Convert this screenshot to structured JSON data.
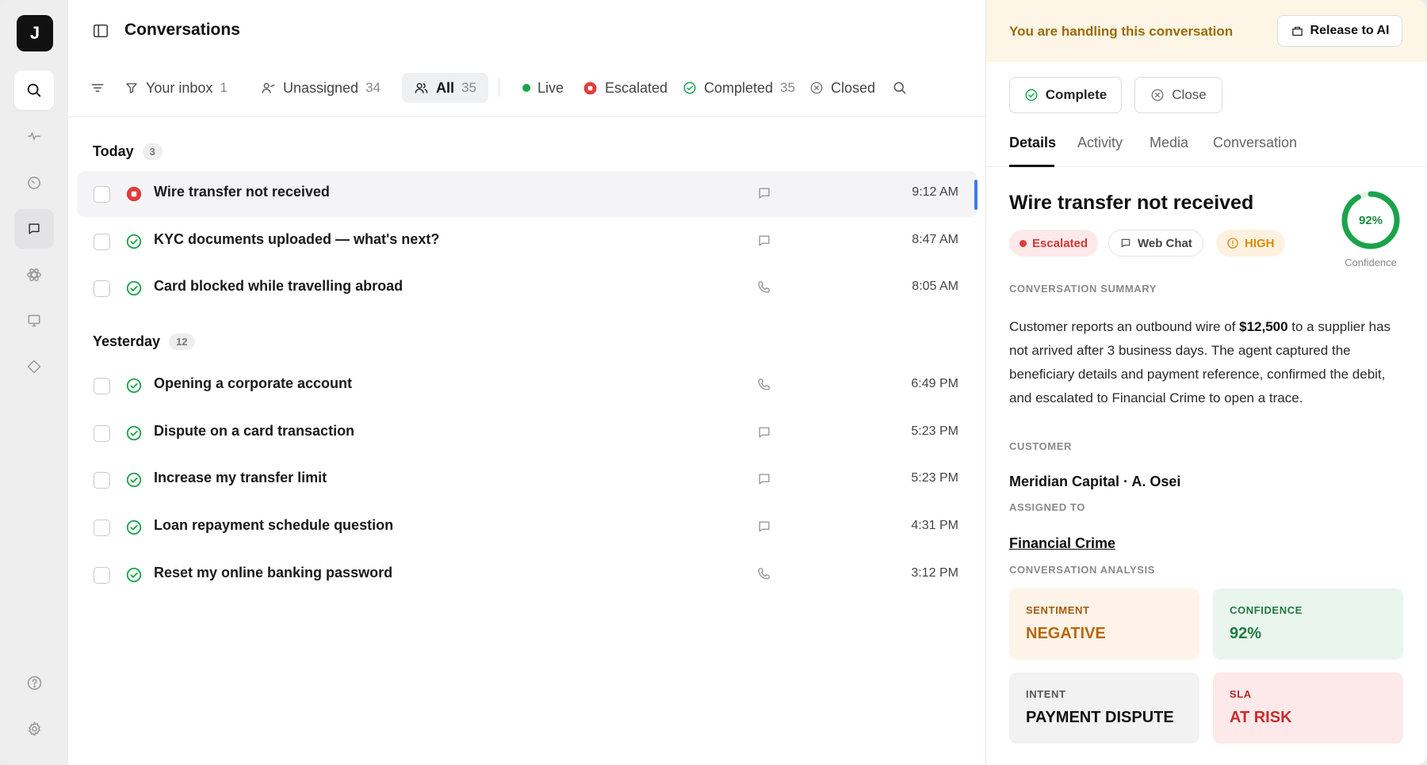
{
  "rail": {
    "logo": "J",
    "items": [
      {
        "name": "search-icon"
      },
      {
        "name": "activity-icon"
      },
      {
        "name": "clock-icon"
      },
      {
        "name": "chat-icon"
      },
      {
        "name": "atom-icon"
      },
      {
        "name": "monitor-icon"
      },
      {
        "name": "diamond-icon"
      },
      {
        "name": "help-icon"
      },
      {
        "name": "gear-icon"
      }
    ]
  },
  "header": {
    "title": "Conversations"
  },
  "filters": {
    "your_inbox": {
      "label": "Your inbox",
      "count": "1"
    },
    "unassigned": {
      "label": "Unassigned",
      "count": "34"
    },
    "all": {
      "label": "All",
      "count": "35"
    },
    "live": {
      "label": "Live"
    },
    "escalated": {
      "label": "Escalated"
    },
    "completed": {
      "label": "Completed",
      "count": "35"
    },
    "closed": {
      "label": "Closed"
    }
  },
  "groups": {
    "today": {
      "label": "Today",
      "count": "3"
    },
    "yesterday": {
      "label": "Yesterday",
      "count": "12"
    }
  },
  "conversations": [
    {
      "title": "Wire transfer not received",
      "status": "escalated",
      "channel": "chat",
      "time": "9:12 AM"
    },
    {
      "title": "KYC documents uploaded — what's next?",
      "status": "completed",
      "channel": "chat",
      "time": "8:47 AM"
    },
    {
      "title": "Card blocked while travelling abroad",
      "status": "completed",
      "channel": "phone",
      "time": "8:05 AM"
    },
    {
      "title": "Opening a corporate account",
      "status": "completed",
      "channel": "phone",
      "time": "6:49 PM"
    },
    {
      "title": "Dispute on a card transaction",
      "status": "completed",
      "channel": "chat",
      "time": "5:23 PM"
    },
    {
      "title": "Increase my transfer limit",
      "status": "completed",
      "channel": "chat",
      "time": "5:23 PM"
    },
    {
      "title": "Loan repayment schedule question",
      "status": "completed",
      "channel": "chat",
      "time": "4:31 PM"
    },
    {
      "title": "Reset my online banking password",
      "status": "completed",
      "channel": "phone",
      "time": "3:12 PM"
    }
  ],
  "detail": {
    "banner": "You are handling this conversation",
    "release_label": "Release to AI",
    "complete_label": "Complete",
    "close_label": "Close",
    "tabs": [
      "Details",
      "Activity",
      "Media",
      "Conversation"
    ],
    "title": "Wire transfer not received",
    "pills": {
      "status": "Escalated",
      "channel": "Web Chat",
      "priority": "HIGH"
    },
    "confidence": {
      "value": 0.92,
      "text": "92%",
      "label": "Confidence"
    },
    "summary_label": "CONVERSATION SUMMARY",
    "summary_pre": "Customer reports an outbound wire of ",
    "summary_amount": "$12,500",
    "summary_post": " to a supplier has not arrived after 3 business days. The agent captured the beneficiary details and payment reference, confirmed the debit, and escalated to Financial Crime to open a trace.",
    "customer_label": "CUSTOMER",
    "customer": "Meridian Capital · A. Osei",
    "assigned_label": "ASSIGNED TO",
    "assigned": "Financial Crime",
    "analysis_label": "CONVERSATION ANALYSIS",
    "analysis": {
      "sentiment": {
        "key": "SENTIMENT",
        "value": "NEGATIVE"
      },
      "confidence": {
        "key": "CONFIDENCE",
        "value": "92%"
      },
      "intent": {
        "key": "INTENT",
        "value": "PAYMENT DISPUTE"
      },
      "sla": {
        "key": "SLA",
        "value": "AT RISK"
      }
    }
  },
  "colors": {
    "accent_blue": "#3a7bea",
    "escalated_red": "#e03c3c",
    "completed_green": "#1aa34a",
    "banner_bg": "#fdf6e6"
  }
}
